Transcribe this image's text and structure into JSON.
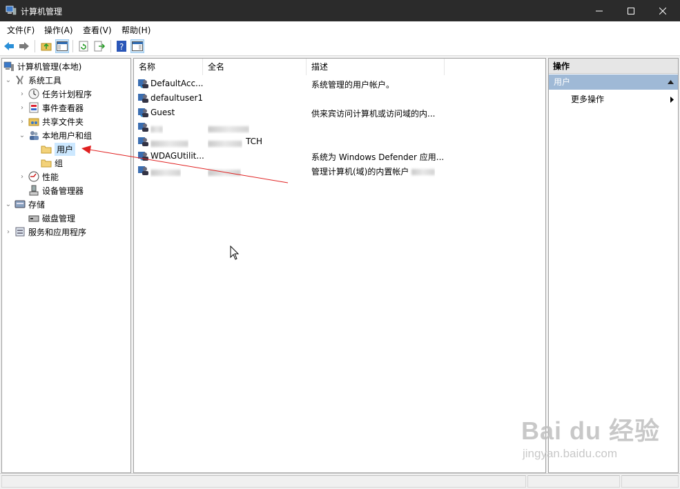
{
  "window": {
    "title": "计算机管理",
    "controls": {
      "minimize": "minimize-icon",
      "maximize": "maximize-icon",
      "close": "close-icon"
    }
  },
  "menu": [
    "文件(F)",
    "操作(A)",
    "查看(V)",
    "帮助(H)"
  ],
  "toolbar": [
    "back-arrow-icon",
    "forward-arrow-icon",
    "up-folder-icon",
    "show-hide-tree-icon",
    "refresh-icon",
    "export-list-icon",
    "help-icon",
    "show-hide-action-pane-icon"
  ],
  "tree": {
    "root": "计算机管理(本地)",
    "system_tools": "系统工具",
    "task_scheduler": "任务计划程序",
    "event_viewer": "事件查看器",
    "shared_folders": "共享文件夹",
    "local_users_groups": "本地用户和组",
    "users": "用户",
    "groups": "组",
    "performance": "性能",
    "device_manager": "设备管理器",
    "storage": "存储",
    "disk_management": "磁盘管理",
    "services_apps": "服务和应用程序"
  },
  "list": {
    "columns": [
      "名称",
      "全名",
      "描述"
    ],
    "rows": [
      {
        "name": "DefaultAcc...",
        "fullname": "",
        "desc": "系统管理的用户帐户。"
      },
      {
        "name": "defaultuser1",
        "fullname": "",
        "desc": ""
      },
      {
        "name": "Guest",
        "fullname": "",
        "desc": "供来宾访问计算机或访问域的内..."
      },
      {
        "name": "",
        "fullname": "",
        "desc": ""
      },
      {
        "name": "",
        "fullname": "TCH",
        "desc": ""
      },
      {
        "name": "WDAGUtilit...",
        "fullname": "",
        "desc": "系统为 Windows Defender 应用..."
      },
      {
        "name": "",
        "fullname": "",
        "desc": "管理计算机(域)的内置帐户"
      }
    ]
  },
  "actions": {
    "header": "操作",
    "section": "用户",
    "more": "更多操作"
  },
  "watermark": {
    "main": "Bai du 经验",
    "sub": "jingyan.baidu.com"
  },
  "colors": {
    "titlebar": "#2b2b2b",
    "selection": "#cce8ff",
    "action_section": "#9fb9d6",
    "annotation_arrow": "#e02020"
  }
}
